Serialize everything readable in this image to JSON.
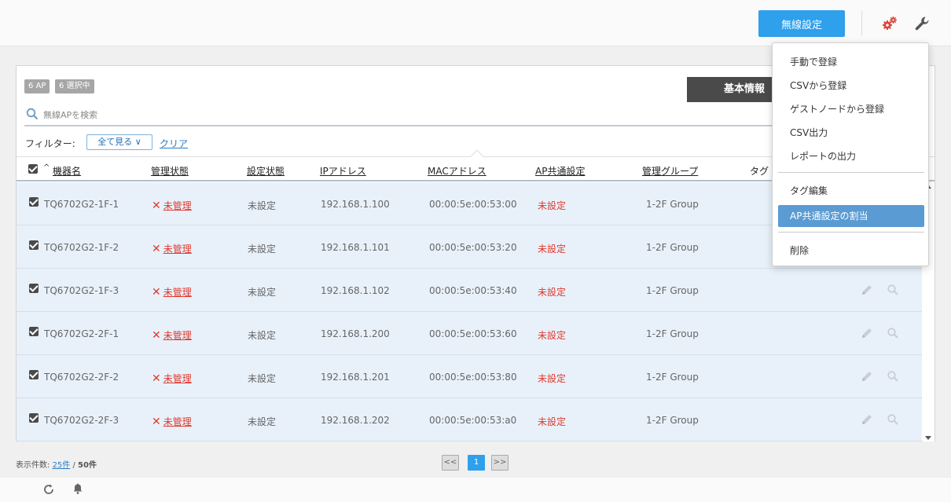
{
  "header": {
    "wireless_settings_label": "無線設定"
  },
  "panel": {
    "ap_count": "6 AP",
    "selected_count": "6 選択中",
    "tab_basic_info": "基本情報",
    "search_placeholder": "無線APを検索",
    "filter_label": "フィルター:",
    "filter_value": "全て見る ∨",
    "filter_clear": "クリア"
  },
  "table": {
    "sort_indicator": "^",
    "columns": {
      "name": "機器名",
      "admin_status": "管理状態",
      "config_status": "設定状態",
      "ip": "IPアドレス",
      "mac": "MACアドレス",
      "ap_common": "AP共通設定",
      "group": "管理グループ",
      "tag": "タグ"
    },
    "rows": [
      {
        "name": "TQ6702G2-1F-1",
        "admin_status": "未管理",
        "config_status": "未設定",
        "ip": "192.168.1.100",
        "mac": "00:00:5e:00:53:00",
        "ap_common": "未設定",
        "group": "1-2F Group"
      },
      {
        "name": "TQ6702G2-1F-2",
        "admin_status": "未管理",
        "config_status": "未設定",
        "ip": "192.168.1.101",
        "mac": "00:00:5e:00:53:20",
        "ap_common": "未設定",
        "group": "1-2F Group"
      },
      {
        "name": "TQ6702G2-1F-3",
        "admin_status": "未管理",
        "config_status": "未設定",
        "ip": "192.168.1.102",
        "mac": "00:00:5e:00:53:40",
        "ap_common": "未設定",
        "group": "1-2F Group"
      },
      {
        "name": "TQ6702G2-2F-1",
        "admin_status": "未管理",
        "config_status": "未設定",
        "ip": "192.168.1.200",
        "mac": "00:00:5e:00:53:60",
        "ap_common": "未設定",
        "group": "1-2F Group"
      },
      {
        "name": "TQ6702G2-2F-2",
        "admin_status": "未管理",
        "config_status": "未設定",
        "ip": "192.168.1.201",
        "mac": "00:00:5e:00:53:80",
        "ap_common": "未設定",
        "group": "1-2F Group"
      },
      {
        "name": "TQ6702G2-2F-3",
        "admin_status": "未管理",
        "config_status": "未設定",
        "ip": "192.168.1.202",
        "mac": "00:00:5e:00:53:a0",
        "ap_common": "未設定",
        "group": "1-2F Group"
      }
    ]
  },
  "footer": {
    "display_count_label": "表示件数:",
    "per_page": "25件",
    "separator": "/",
    "total": "50件",
    "pager_prev": "<<",
    "pager_page": "1",
    "pager_next": ">>"
  },
  "menu": {
    "items": [
      "手動で登録",
      "CSVから登録",
      "ゲストノードから登録",
      "CSV出力",
      "レポートの出力",
      "タグ編集",
      "AP共通設定の割当",
      "削除"
    ],
    "active_item": "AP共通設定の割当"
  },
  "colors": {
    "accent": "#2ea0ec",
    "error": "#e03a2f",
    "row_selected": "#e8f1fa",
    "menu_active": "#5b9bd3"
  },
  "icons": [
    "gears-icon",
    "wrench-icon",
    "search-icon",
    "pencil-icon",
    "magnifier-icon",
    "refresh-icon",
    "bell-icon"
  ]
}
